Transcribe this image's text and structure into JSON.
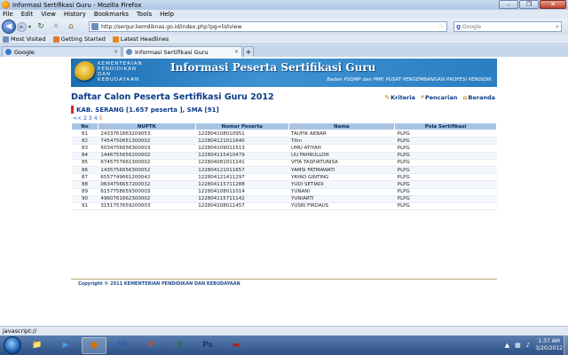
{
  "window": {
    "title": "Informasi Sertifikasi Guru - Mozilla Firefox",
    "minimize": "–",
    "maximize": "❐",
    "close": "✕"
  },
  "menu": [
    "File",
    "Edit",
    "View",
    "History",
    "Bookmarks",
    "Tools",
    "Help"
  ],
  "navigation": {
    "url": "http://sergur.kemdiknas.go.id/index.php?pg=listview",
    "search_placeholder": "Google"
  },
  "bookmarks": [
    {
      "label": "Most Visited",
      "color": "#6f8fbf"
    },
    {
      "label": "Getting Started",
      "color": "#e07a30"
    },
    {
      "label": "Latest Headlines",
      "color": "#e28a20"
    }
  ],
  "tabs": [
    {
      "label": "Google",
      "active": false,
      "color": "#3b76c7"
    },
    {
      "label": "Informasi Sertifikasi Guru",
      "active": true,
      "color": "#6a8fbf"
    }
  ],
  "banner": {
    "ministry": "KEMENTERIAN PENDIDIKAN DAN KEBUDAYAAN",
    "title": "Informasi Peserta Sertifikasi Guru",
    "subtitle": "Badan PSDMP dan PMP, PUSAT PENGEMBANGAN PROFESI PENDIDIK"
  },
  "page": {
    "heading": "Daftar Calon Peserta Sertifikasi Guru 2012",
    "links": [
      "Kriteria",
      "Pencarian",
      "Beranda"
    ],
    "subheading": "KAB. SERANG [1.657 peserta ], SMA [91]",
    "pagination": {
      "prev": "<<",
      "pages": [
        "2",
        "3",
        "4"
      ],
      "current": "5"
    }
  },
  "table": {
    "headers": [
      "No",
      "NUPTK",
      "Nomor Peserta",
      "Nama",
      "Pola Sertifikasi"
    ],
    "rows": [
      [
        "81",
        "2433761663209053",
        "122804108010951",
        "TAUFIK AKBAR",
        "PLPG"
      ],
      [
        "82",
        "7454750651300002",
        "122804121011640",
        "Titin",
        "PLPG"
      ],
      [
        "83",
        "5034756656300003",
        "122804109011513",
        "UMU ATIYAH",
        "PLPG"
      ],
      [
        "84",
        "1446755656200002",
        "122804115410479",
        "UU FAHRULLOH",
        "PLPG"
      ],
      [
        "85",
        "6745757661300002",
        "122804081011141",
        "VITA TASPIATUNISA",
        "PLPG"
      ],
      [
        "86",
        "1435756656300052",
        "122804121011657",
        "YAMSI FATMAWATI",
        "PLPG"
      ],
      [
        "87",
        "6557749661200042",
        "122804121411297",
        "YAYAD GINTING",
        "PLPG"
      ],
      [
        "88",
        "0634756657200032",
        "122804115711288",
        "YUDI SETIADI",
        "PLPG"
      ],
      [
        "89",
        "6157758659300003",
        "122804108011014",
        "YUNANI",
        "PLPG"
      ],
      [
        "90",
        "4960761662300002",
        "122804115711142",
        "YUNIARTI",
        "PLPG"
      ],
      [
        "91",
        "3151757659200003",
        "122804108011457",
        "YUSRI FIRDAUS",
        "PLPG"
      ]
    ]
  },
  "footer": {
    "copyright": "Copyright © 2011 KEMENTERIAN PENDIDIKAN DAN KEBUDAYAAN"
  },
  "status": "javascript://",
  "taskbar": {
    "items": [
      {
        "name": "explorer-icon",
        "glyph": "📁",
        "color": "#e3b23c"
      },
      {
        "name": "media-player-icon",
        "glyph": "▶",
        "color": "#3ea0e0"
      },
      {
        "name": "firefox-icon",
        "glyph": "●",
        "color": "#e06a00",
        "active": true
      },
      {
        "name": "word-icon",
        "glyph": "W",
        "color": "#2b5fb3"
      },
      {
        "name": "powerpoint-icon",
        "glyph": "P",
        "color": "#d04a1c"
      },
      {
        "name": "excel-icon",
        "glyph": "X",
        "color": "#1f7a3a"
      },
      {
        "name": "photoshop-icon",
        "glyph": "Ps",
        "color": "#1d3a66"
      },
      {
        "name": "app-icon",
        "glyph": "▬",
        "color": "#b02020"
      }
    ],
    "time": "1:37 AM",
    "date": "3/20/2012"
  }
}
